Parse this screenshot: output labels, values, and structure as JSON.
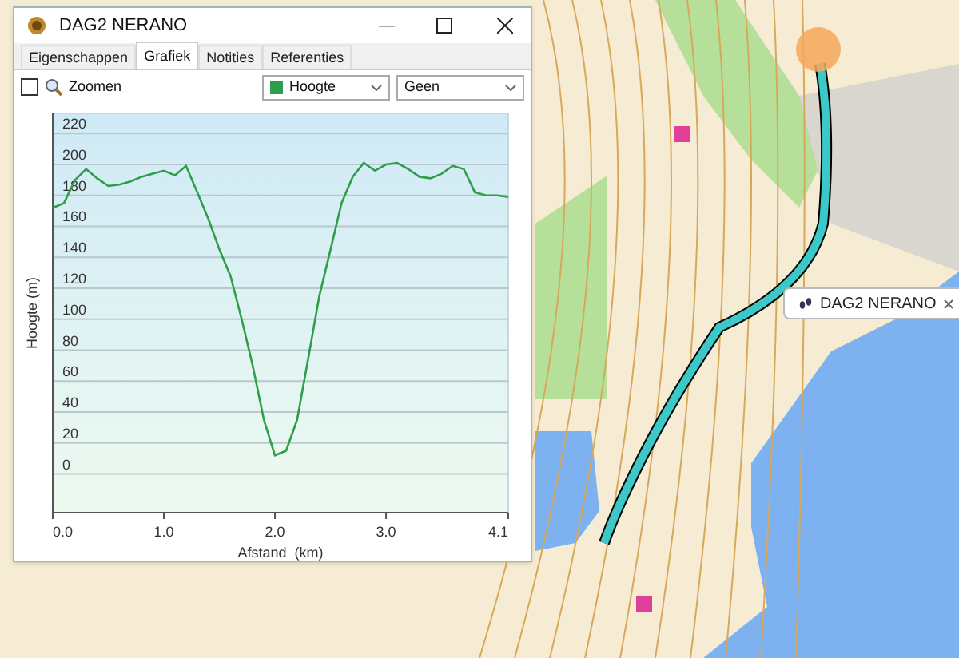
{
  "window": {
    "title": "DAG2 NERANO"
  },
  "tabs": [
    {
      "label": "Eigenschappen",
      "selected": false
    },
    {
      "label": "Grafiek",
      "selected": true
    },
    {
      "label": "Notities",
      "selected": false
    },
    {
      "label": "Referenties",
      "selected": false
    }
  ],
  "toolbar": {
    "zoom": {
      "label": "Zoomen",
      "checked": false
    },
    "selects": [
      {
        "kind": "series"
      },
      {
        "kind": "text",
        "value": "Geen"
      }
    ]
  },
  "chart": {
    "chart_data": {
      "type": "line",
      "xlabel": "Afstand  (km)",
      "ylabel": "Hoogte (m)",
      "grid": true,
      "xlim": [
        0,
        4.1
      ],
      "ylim": [
        -25,
        233
      ],
      "xticks": [
        {
          "value": 0,
          "label": "0.0"
        },
        {
          "value": 1,
          "label": "1.0"
        },
        {
          "value": 2,
          "label": "2.0"
        },
        {
          "value": 3,
          "label": "3.0"
        },
        {
          "value": 4.1,
          "label": "4.1"
        }
      ],
      "yticks": [
        0,
        20,
        40,
        60,
        80,
        100,
        120,
        140,
        160,
        180,
        200,
        220
      ],
      "x": [
        0,
        0.1,
        0.2,
        0.3,
        0.4,
        0.5,
        0.6,
        0.7,
        0.8,
        0.9,
        1.0,
        1.1,
        1.2,
        1.3,
        1.4,
        1.5,
        1.6,
        1.7,
        1.8,
        1.9,
        2.0,
        2.1,
        2.2,
        2.3,
        2.4,
        2.5,
        2.6,
        2.7,
        2.8,
        2.9,
        3.0,
        3.1,
        3.2,
        3.3,
        3.4,
        3.5,
        3.6,
        3.7,
        3.8,
        3.9,
        4.0,
        4.1
      ],
      "series": [
        {
          "name": "Hoogte",
          "color": "#2e9e4a",
          "values": [
            172,
            175,
            190,
            197,
            191,
            186,
            187,
            189,
            192,
            194,
            196,
            193,
            199,
            182,
            165,
            145,
            128,
            100,
            70,
            35,
            12,
            15,
            35,
            75,
            115,
            145,
            175,
            192,
            201,
            196,
            200,
            201,
            197,
            192,
            191,
            194,
            199,
            197,
            182,
            180,
            180,
            179
          ]
        }
      ]
    }
  },
  "map": {
    "popup": {
      "label": "DAG2 NERANO"
    }
  }
}
